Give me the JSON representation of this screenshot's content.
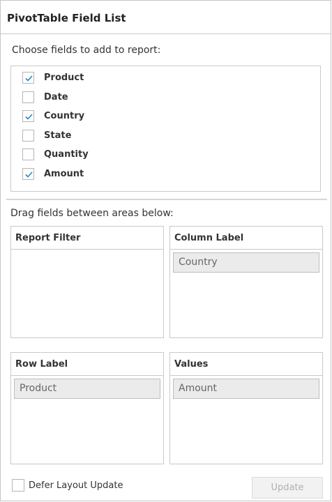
{
  "title": "PivotTable Field List",
  "choose_label": "Choose fields to add to report:",
  "fields": [
    {
      "name": "Product",
      "checked": true
    },
    {
      "name": "Date",
      "checked": false
    },
    {
      "name": "Country",
      "checked": true
    },
    {
      "name": "State",
      "checked": false
    },
    {
      "name": "Quantity",
      "checked": false
    },
    {
      "name": "Amount",
      "checked": true
    }
  ],
  "drag_label": "Drag fields between areas below:",
  "areas": {
    "report_filter": {
      "label": "Report Filter",
      "items": []
    },
    "column_label": {
      "label": "Column Label",
      "items": [
        "Country"
      ]
    },
    "row_label": {
      "label": "Row Label",
      "items": [
        "Product"
      ]
    },
    "values": {
      "label": "Values",
      "items": [
        "Amount"
      ]
    }
  },
  "defer": {
    "label": "Defer Layout Update",
    "checked": false
  },
  "update_button": {
    "label": "Update",
    "disabled": true
  },
  "colors": {
    "check": "#1e88c7",
    "chip_bg": "#ebebeb",
    "border": "#c9c9c9"
  }
}
